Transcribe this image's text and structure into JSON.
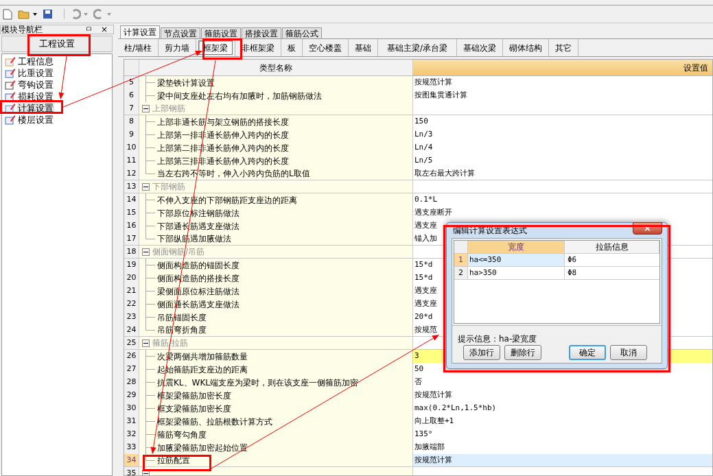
{
  "toolbar": [
    {
      "kind": "new",
      "disabled": false
    },
    {
      "kind": "open",
      "disabled": false,
      "dropdown": true
    },
    {
      "kind": "save",
      "disabled": false
    },
    {
      "kind": "undo",
      "disabled": true,
      "dropdown": true
    },
    {
      "kind": "redo",
      "disabled": true,
      "dropdown": true
    }
  ],
  "nav": {
    "title": "模块导航栏",
    "pin": "ㅁ",
    "close": "×",
    "section": "工程设置",
    "items": [
      {
        "label": "工程信息",
        "kind": "info",
        "selected": false
      },
      {
        "label": "比重设置",
        "kind": "weight",
        "selected": false
      },
      {
        "label": "弯钩设置",
        "kind": "hook",
        "selected": false
      },
      {
        "label": "损耗设置",
        "kind": "loss",
        "selected": false
      },
      {
        "label": "计算设置",
        "kind": "calc",
        "selected": true
      },
      {
        "label": "楼层设置",
        "kind": "floor",
        "selected": false
      }
    ]
  },
  "tabs": [
    {
      "label": "计算设置",
      "selected": true
    },
    {
      "label": "节点设置",
      "selected": false
    },
    {
      "label": "箍筋设置",
      "selected": false
    },
    {
      "label": "搭接设置",
      "selected": false
    },
    {
      "label": "箍筋公式",
      "selected": false
    }
  ],
  "subtabs": [
    {
      "label": "柱/墙柱",
      "selected": false
    },
    {
      "label": "剪力墙",
      "selected": false
    },
    {
      "label": "框架梁",
      "selected": true
    },
    {
      "label": "非框架梁",
      "selected": false
    },
    {
      "label": "板",
      "selected": false
    },
    {
      "label": "空心楼盖",
      "selected": false
    },
    {
      "label": "基础",
      "selected": false
    },
    {
      "label": "基础主梁/承台梁",
      "selected": false
    },
    {
      "label": "基础次梁",
      "selected": false
    },
    {
      "label": "砌体结构",
      "selected": false
    },
    {
      "label": "其它",
      "selected": false
    }
  ],
  "table": {
    "columns": [
      "类型名称",
      "设置值"
    ],
    "rows": [
      {
        "number": "5",
        "name": "梁垫铁计算设置",
        "value": "按规范计算",
        "selected": false,
        "highlighted": false
      },
      {
        "number": "6",
        "name": "梁中间支座处左右均有加腋时，加筋钢筋做法",
        "value": "按图集贯通计算",
        "selected": false,
        "highlighted": false
      },
      {
        "number": "7",
        "name": "上部钢筋",
        "expanded": true,
        "selected": false,
        "children": [
          {
            "number": "8",
            "name": "上部非通长筋与架立钢筋的搭接长度",
            "value": "150",
            "selected": false,
            "highlighted": false
          },
          {
            "number": "9",
            "name": "上部第一排非通长筋伸入跨内的长度",
            "value": "Ln/3",
            "selected": false,
            "highlighted": false
          },
          {
            "number": "10",
            "name": "上部第二排非通长筋伸入跨内的长度",
            "value": "Ln/4",
            "selected": false,
            "highlighted": false
          },
          {
            "number": "11",
            "name": "上部第三排非通长筋伸入跨内的长度",
            "value": "Ln/5",
            "selected": false,
            "highlighted": false
          },
          {
            "number": "12",
            "name": "当左右跨不等时，伸入小跨内负筋的L取值",
            "value": "取左右最大跨计算",
            "selected": false,
            "highlighted": false
          }
        ]
      },
      {
        "number": "13",
        "name": "下部钢筋",
        "expanded": true,
        "selected": false,
        "children": [
          {
            "number": "14",
            "name": "不伸入支座的下部钢筋距支座边的距离",
            "value": "0.1*L",
            "selected": false,
            "highlighted": false
          },
          {
            "number": "15",
            "name": "下部原位标注钢筋做法",
            "value": "遇支座断开",
            "selected": false,
            "highlighted": false
          },
          {
            "number": "16",
            "name": "下部通长筋遇支座做法",
            "value": "遇支座",
            "selected": false,
            "highlighted": false
          },
          {
            "number": "17",
            "name": "下部纵筋遇加腋做法",
            "value": "锚入加",
            "selected": false,
            "highlighted": false
          }
        ]
      },
      {
        "number": "18",
        "name": "侧面钢筋/吊筋",
        "expanded": true,
        "selected": false,
        "children": [
          {
            "number": "19",
            "name": "侧面构造筋的锚固长度",
            "value": "15*d",
            "selected": false,
            "highlighted": false
          },
          {
            "number": "20",
            "name": "侧面构造筋的搭接长度",
            "value": "15*d",
            "selected": false,
            "highlighted": false
          },
          {
            "number": "21",
            "name": "梁侧面原位标注筋做法",
            "value": "遇支座",
            "selected": false,
            "highlighted": false
          },
          {
            "number": "22",
            "name": "侧面通长筋遇支座做法",
            "value": "遇支座",
            "selected": false,
            "highlighted": false
          },
          {
            "number": "23",
            "name": "吊筋锚固长度",
            "value": "20*d",
            "selected": false,
            "highlighted": false
          },
          {
            "number": "24",
            "name": "吊筋弯折角度",
            "value": "按规范",
            "selected": false,
            "highlighted": false
          }
        ]
      },
      {
        "number": "25",
        "name": "箍筋/拉筋",
        "expanded": true,
        "selected": false,
        "children": [
          {
            "number": "26",
            "name": "次梁两侧共增加箍筋数量",
            "value": "3",
            "selected": false,
            "highlighted": true
          },
          {
            "number": "27",
            "name": "起始箍筋距支座边的距离",
            "value": "50",
            "selected": false,
            "highlighted": false
          },
          {
            "number": "28",
            "name": "抗震KL、WKL端支座为梁时，则在该支座一侧箍筋加密",
            "value": "否",
            "selected": false,
            "highlighted": false
          },
          {
            "number": "29",
            "name": "框架梁箍筋加密长度",
            "value": "按规范计算",
            "selected": false,
            "highlighted": false
          },
          {
            "number": "30",
            "name": "框支梁箍筋加密长度",
            "value": "max(0.2*Ln,1.5*hb)",
            "selected": false,
            "highlighted": false
          },
          {
            "number": "31",
            "name": "框架梁箍筋、拉筋根数计算方式",
            "value": "向上取整+1",
            "selected": false,
            "highlighted": false
          },
          {
            "number": "32",
            "name": "箍筋弯勾角度",
            "value": "135°",
            "selected": false,
            "highlighted": false
          },
          {
            "number": "33",
            "name": "加腋梁箍筋加密起始位置",
            "value": "加腋端部",
            "selected": false,
            "highlighted": false
          },
          {
            "number": "34",
            "name": "拉筋配置",
            "value": "按规范计算",
            "selected": true,
            "highlighted": false
          }
        ]
      },
      {
        "number": "35",
        "expanded": true,
        "selected": false,
        "children": []
      }
    ]
  },
  "dialog": {
    "title": "编辑计算设置表达式",
    "close": "×",
    "columns": [
      {
        "label": "宽度",
        "selected": true
      },
      {
        "label": "拉筋信息",
        "selected": false
      }
    ],
    "rows": [
      {
        "number": "1",
        "width": "ha<=350",
        "info": "Φ6",
        "selected": true
      },
      {
        "number": "2",
        "width": "ha>350",
        "info": "Φ8",
        "selected": false
      }
    ],
    "hint": "提示信息：ha-梁宽度",
    "buttons": [
      {
        "label": "添加行",
        "default": false
      },
      {
        "label": "删除行",
        "default": false
      },
      {
        "label": "确定",
        "default": true
      },
      {
        "label": "取消",
        "default": false
      }
    ]
  }
}
